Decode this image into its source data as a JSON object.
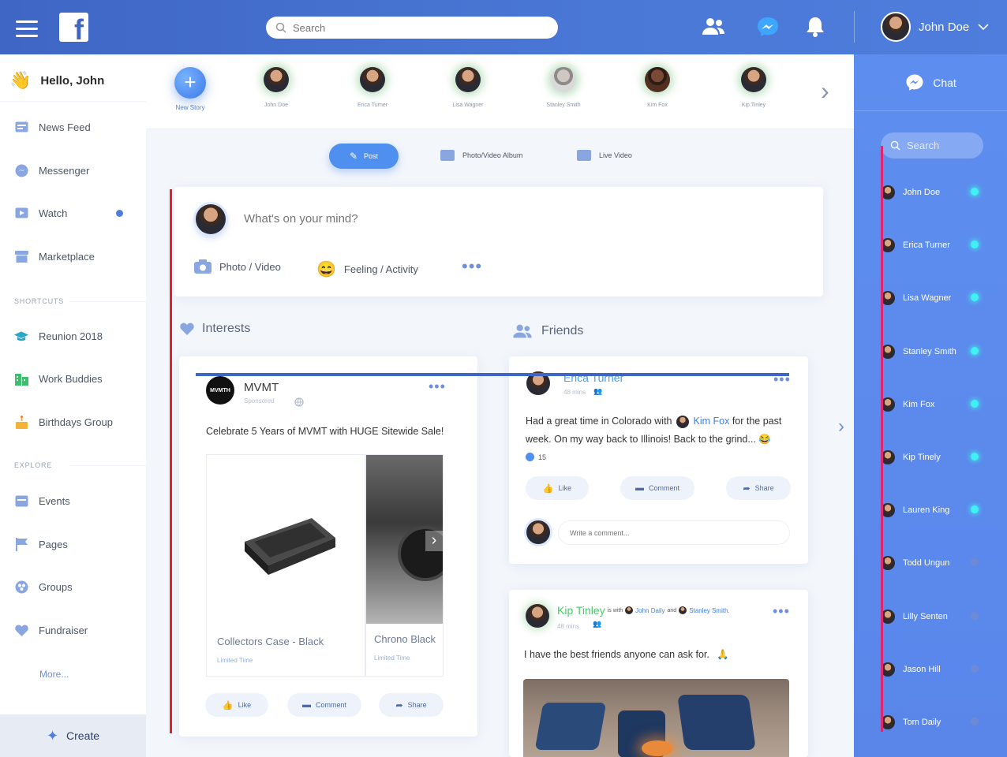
{
  "topbar": {
    "search_placeholder": "Search",
    "user_name": "John Doe"
  },
  "sidebar": {
    "greeting": "Hello, John",
    "items": [
      {
        "label": "News Feed",
        "icon": "news-feed-icon"
      },
      {
        "label": "Messenger",
        "icon": "messenger-icon"
      },
      {
        "label": "Watch",
        "icon": "watch-icon",
        "badge": true
      },
      {
        "label": "Marketplace",
        "icon": "marketplace-icon"
      }
    ],
    "shortcuts_label": "SHORTCUTS",
    "shortcuts": [
      {
        "label": "Reunion 2018",
        "icon": "graduation-cap-icon"
      },
      {
        "label": "Work Buddies",
        "icon": "building-icon"
      },
      {
        "label": "Birthdays Group",
        "icon": "cake-icon"
      }
    ],
    "explore_label": "EXPLORE",
    "explore": [
      {
        "label": "Events",
        "icon": "calendar-icon"
      },
      {
        "label": "Pages",
        "icon": "flag-icon"
      },
      {
        "label": "Groups",
        "icon": "groups-icon"
      },
      {
        "label": "Fundraiser",
        "icon": "heart-icon"
      }
    ],
    "more": "More...",
    "create": "Create"
  },
  "stories": {
    "new_story": "New Story",
    "people": [
      "John Doe",
      "Erica Turner",
      "Lisa Wagner",
      "Stanley Smith",
      "Kim Fox",
      "Kip Tinley"
    ]
  },
  "post_tabs": {
    "post": "Post",
    "album": "Photo/Video Album",
    "live": "Live Video"
  },
  "composer": {
    "placeholder": "What's on your mind?",
    "photo": "Photo / Video",
    "feeling": "Feeling / Activity"
  },
  "sections": {
    "interests": "Interests",
    "friends": "Friends"
  },
  "ad_card": {
    "logo_text": "MVMTH",
    "brand": "MVMT",
    "sponsored": "Sponsored",
    "text": "Celebrate 5 Years of MVMT with HUGE Sitewide Sale!",
    "products": [
      {
        "name": "Collectors Case - Black",
        "limit": "Limited Time"
      },
      {
        "name": "Chrono Black",
        "limit": "Limited Time"
      }
    ],
    "like": "Like",
    "comment": "Comment",
    "share": "Share"
  },
  "post1": {
    "author": "Erica Turner",
    "time": "48 mins",
    "text_before": "Had a great time in Colorado with",
    "tagged": "Kim Fox",
    "text_after": "for the past week. On my way back to Illinois! Back to the grind...",
    "likes": "15",
    "like": "Like",
    "comment": "Comment",
    "share": "Share",
    "comment_placeholder": "Write a comment..."
  },
  "post2": {
    "author": "Kip Tinley",
    "with": "is with",
    "friend1": "John Daily",
    "and": "and",
    "friend2": "Stanley Smith.",
    "time": "48 mins",
    "text": "I have the best friends anyone can ask for."
  },
  "chat": {
    "title": "Chat",
    "search_placeholder": "Search",
    "contacts": [
      {
        "name": "John Doe",
        "online": true
      },
      {
        "name": "Erica Turner",
        "online": true
      },
      {
        "name": "Lisa Wagner",
        "online": true
      },
      {
        "name": "Stanley Smith",
        "online": true
      },
      {
        "name": "Kim Fox",
        "online": true
      },
      {
        "name": "Kip Tinely",
        "online": true
      },
      {
        "name": "Lauren King",
        "online": true
      },
      {
        "name": "Todd Ungun",
        "online": false
      },
      {
        "name": "Lilly Senten",
        "online": false
      },
      {
        "name": "Jason Hill",
        "online": false
      },
      {
        "name": "Tom Daily",
        "online": false
      }
    ]
  },
  "colors": {
    "brand": "#3f66c4",
    "accent": "#4f8ff0",
    "online": "#3ff2f2",
    "offline": "#6f8ad4",
    "green_name": "#4cc86a"
  }
}
